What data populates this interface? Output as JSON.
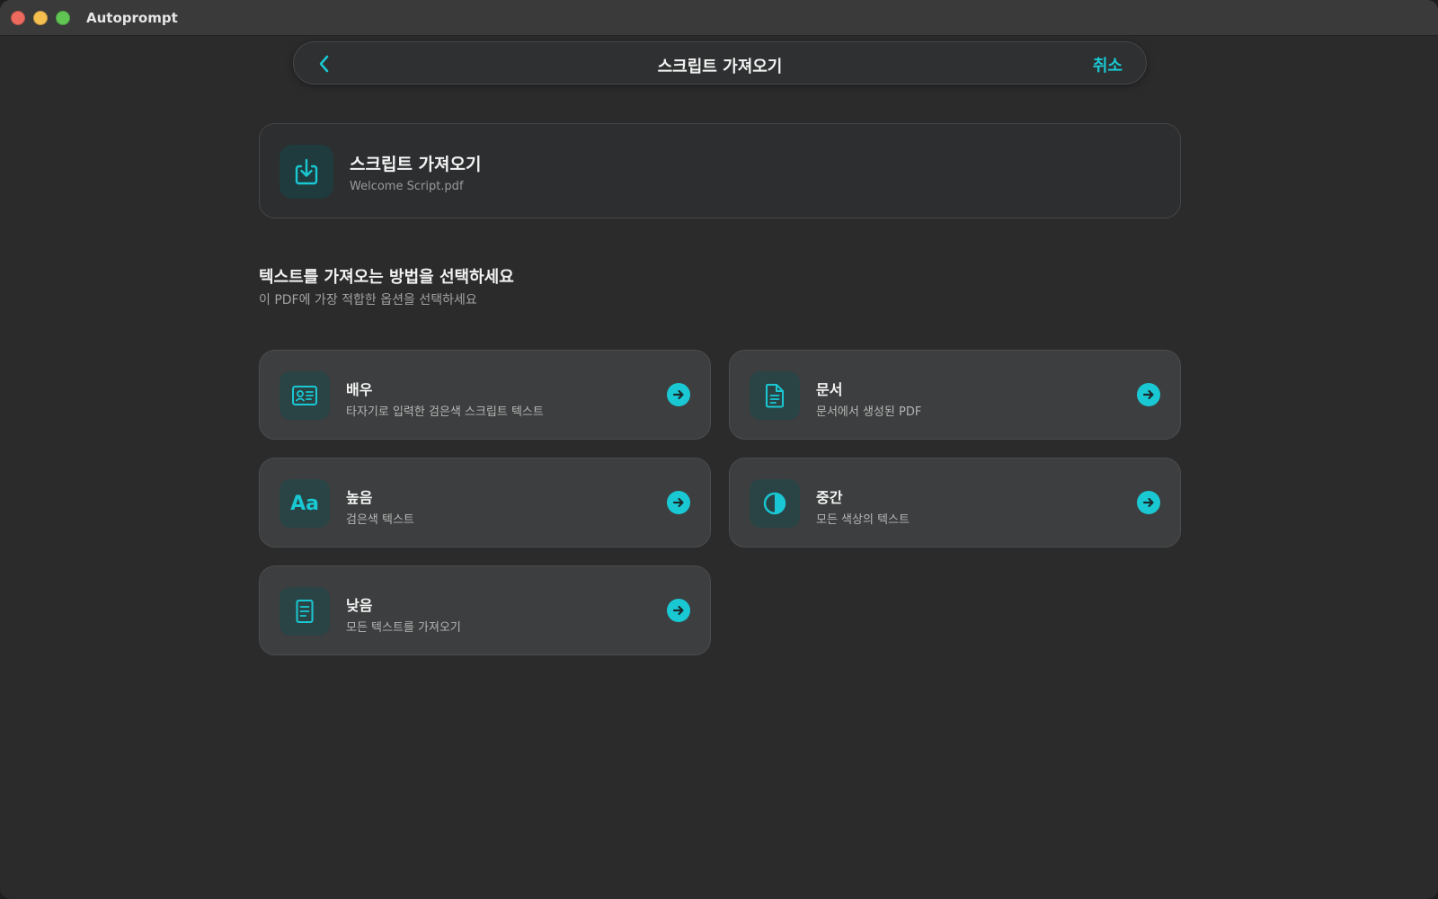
{
  "window": {
    "app_title": "Autoprompt"
  },
  "nav": {
    "title": "스크립트 가져오기",
    "cancel_label": "취소",
    "back_icon": "chevron-left-icon"
  },
  "file_card": {
    "title": "스크립트 가져오기",
    "filename": "Welcome Script.pdf",
    "icon": "import-download-icon"
  },
  "section": {
    "heading": "텍스트를 가져오는 방법을 선택하세요",
    "subheading": "이 PDF에 가장 적합한 옵션을 선택하세요"
  },
  "options": [
    {
      "title": "배우",
      "description": "타자기로 입력한 검은색 스크립트 텍스트",
      "icon": "id-card-icon"
    },
    {
      "title": "문서",
      "description": "문서에서 생성된 PDF",
      "icon": "document-icon"
    },
    {
      "title": "높음",
      "description": "검은색 텍스트",
      "icon": "text-aa-icon",
      "icon_text": "Aa"
    },
    {
      "title": "중간",
      "description": "모든 색상의 텍스트",
      "icon": "contrast-icon"
    },
    {
      "title": "낮음",
      "description": "모든 텍스트를 가져오기",
      "icon": "page-icon"
    }
  ],
  "colors": {
    "accent": "#19c8d3",
    "background": "#2b2b2c",
    "card": "#3d3e3f",
    "icon_tile": "#2a4446"
  }
}
